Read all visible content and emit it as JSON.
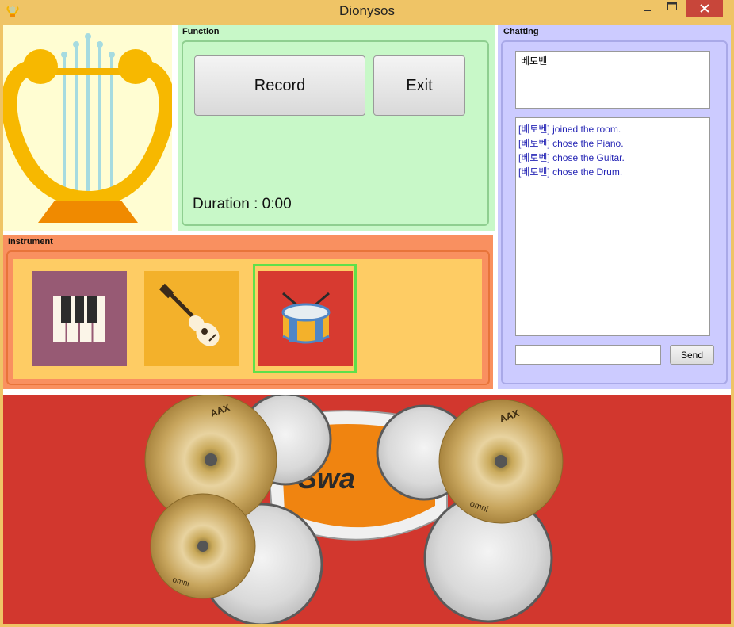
{
  "window": {
    "title": "Dionysos"
  },
  "function": {
    "group_label": "Function",
    "record_label": "Record",
    "exit_label": "Exit",
    "duration_label": "Duration : 0:00"
  },
  "instrument": {
    "group_label": "Instrument",
    "items": [
      {
        "name": "piano",
        "icon": "piano-icon",
        "color": "#975a74"
      },
      {
        "name": "guitar",
        "icon": "guitar-icon",
        "color": "#f3b12b"
      },
      {
        "name": "drum",
        "icon": "drum-icon",
        "color": "#d73a30",
        "selected": true
      }
    ],
    "selection_color": "#5ee04a"
  },
  "chat": {
    "group_label": "Chatting",
    "users": [
      "베토벤"
    ],
    "messages": [
      {
        "user": "[베토벤]",
        "text": " joined the room."
      },
      {
        "user": "[베토벤]",
        "text": " chose the Piano."
      },
      {
        "user": "[베토벤]",
        "text": " chose the Guitar."
      },
      {
        "user": "[베토벤]",
        "text": " chose the Drum."
      }
    ],
    "input_value": "",
    "send_label": "Send"
  },
  "drum_kit": {
    "bass_drum_text": "Swa",
    "cymbal_brand": "AAX",
    "cymbal_model": "omni"
  },
  "colors": {
    "title_bar": "#efc466",
    "function_bg": "#c8f8c8",
    "instrument_bg": "#f99060",
    "chat_bg": "#cccbff",
    "stage_bg": "#d2372e",
    "close_button": "#c8463a"
  }
}
